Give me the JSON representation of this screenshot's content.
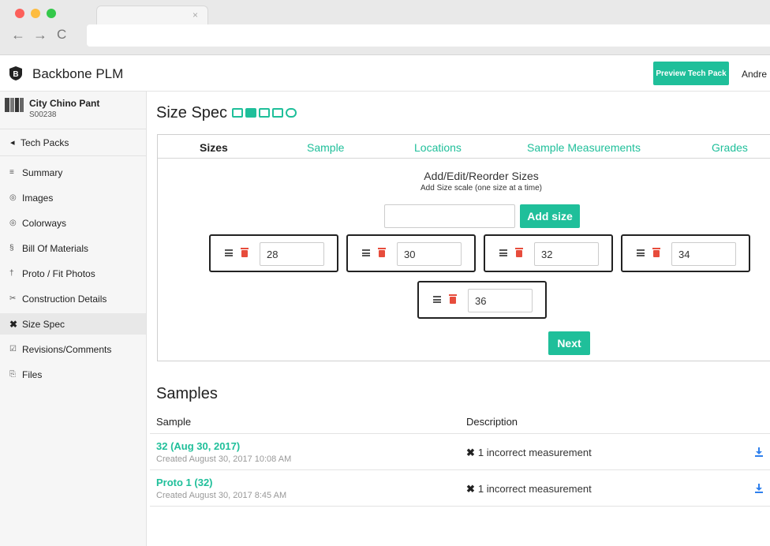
{
  "browser": {
    "tab_close": "×",
    "back": "←",
    "forward": "→",
    "reload": "C"
  },
  "header": {
    "brand": "Backbone PLM",
    "logo_letter": "B",
    "preview_label": "Preview Tech Pack",
    "user": "Andre"
  },
  "sidebar": {
    "product_name": "City Chino Pant",
    "product_code": "S00238",
    "tech_packs": "Tech Packs",
    "tech_packs_icon": "◂",
    "items": [
      {
        "label": "Summary",
        "icon": "≡"
      },
      {
        "label": "Images",
        "icon": "◎"
      },
      {
        "label": "Colorways",
        "icon": "◎"
      },
      {
        "label": "Bill Of Materials",
        "icon": "§"
      },
      {
        "label": "Proto / Fit Photos",
        "icon": "†"
      },
      {
        "label": "Construction Details",
        "icon": "✂"
      },
      {
        "label": "Size Spec",
        "icon": "✖"
      },
      {
        "label": "Revisions/Comments",
        "icon": "☑"
      },
      {
        "label": "Files",
        "icon": "⎘"
      }
    ]
  },
  "main": {
    "title": "Size Spec",
    "tabs": [
      "Sizes",
      "Sample",
      "Locations",
      "Sample Measurements",
      "Grades"
    ],
    "add_title": "Add/Edit/Reorder Sizes",
    "add_subtitle": "Add Size scale (one size at a time)",
    "add_input_value": "",
    "add_button": "Add size",
    "sizes": [
      "28",
      "30",
      "32",
      "34",
      "36"
    ],
    "next_button": "Next"
  },
  "samples": {
    "title": "Samples",
    "col_sample": "Sample",
    "col_description": "Description",
    "rows": [
      {
        "name": "32 (Aug 30, 2017)",
        "created": "Created August 30, 2017 10:08 AM",
        "x": "✖",
        "description": "1 incorrect measurement"
      },
      {
        "name": "Proto 1 (32)",
        "created": "Created August 30, 2017 8:45 AM",
        "x": "✖",
        "description": "1 incorrect measurement"
      }
    ]
  },
  "colors": {
    "accent": "#1fbf9a",
    "danger": "#e74c3c"
  }
}
